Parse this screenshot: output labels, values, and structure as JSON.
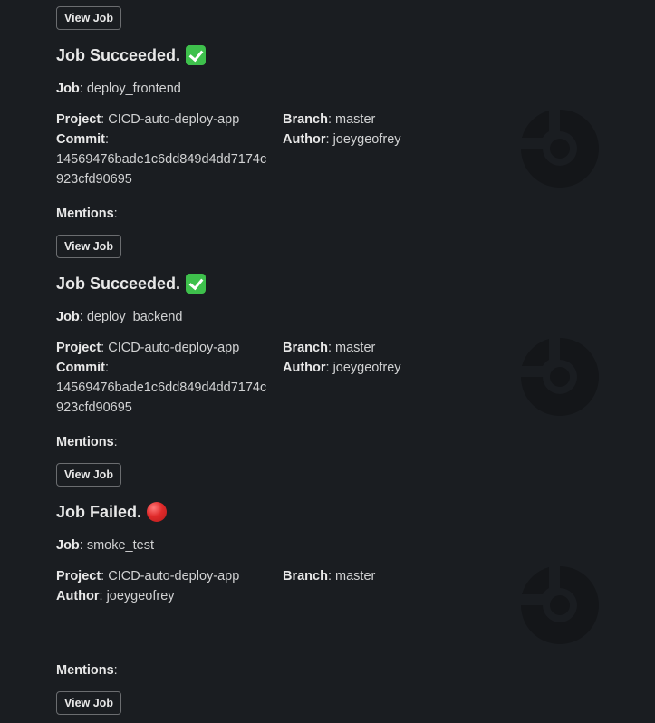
{
  "buttons": {
    "view_job": "View Job"
  },
  "labels": {
    "job": "Job",
    "project": "Project",
    "branch": "Branch",
    "commit": "Commit",
    "author": "Author",
    "mentions": "Mentions",
    "separator": ":"
  },
  "jobs": [
    {
      "title": "Job Succeeded.",
      "status": "success",
      "status_icon": "white-check-mark-emoji",
      "job_name": "deploy_frontend",
      "project": "CICD-auto-deploy-app",
      "branch": "master",
      "commit": "14569476bade1c6dd849d4dd7174c923cfd90695",
      "author": "joeygeofrey",
      "mentions": ""
    },
    {
      "title": "Job Succeeded.",
      "status": "success",
      "status_icon": "white-check-mark-emoji",
      "job_name": "deploy_backend",
      "project": "CICD-auto-deploy-app",
      "branch": "master",
      "commit": "14569476bade1c6dd849d4dd7174c923cfd90695",
      "author": "joeygeofrey",
      "mentions": ""
    },
    {
      "title": "Job Failed.",
      "status": "failed",
      "status_icon": "red-circle-emoji",
      "job_name": "smoke_test",
      "project": "CICD-auto-deploy-app",
      "branch": "master",
      "author": "joeygeofrey",
      "mentions": ""
    }
  ],
  "colors": {
    "background": "#1a1d21",
    "text": "#d1d2d3",
    "success": "#3ec04c",
    "failed": "#e02a2a",
    "logo": "#141619"
  }
}
